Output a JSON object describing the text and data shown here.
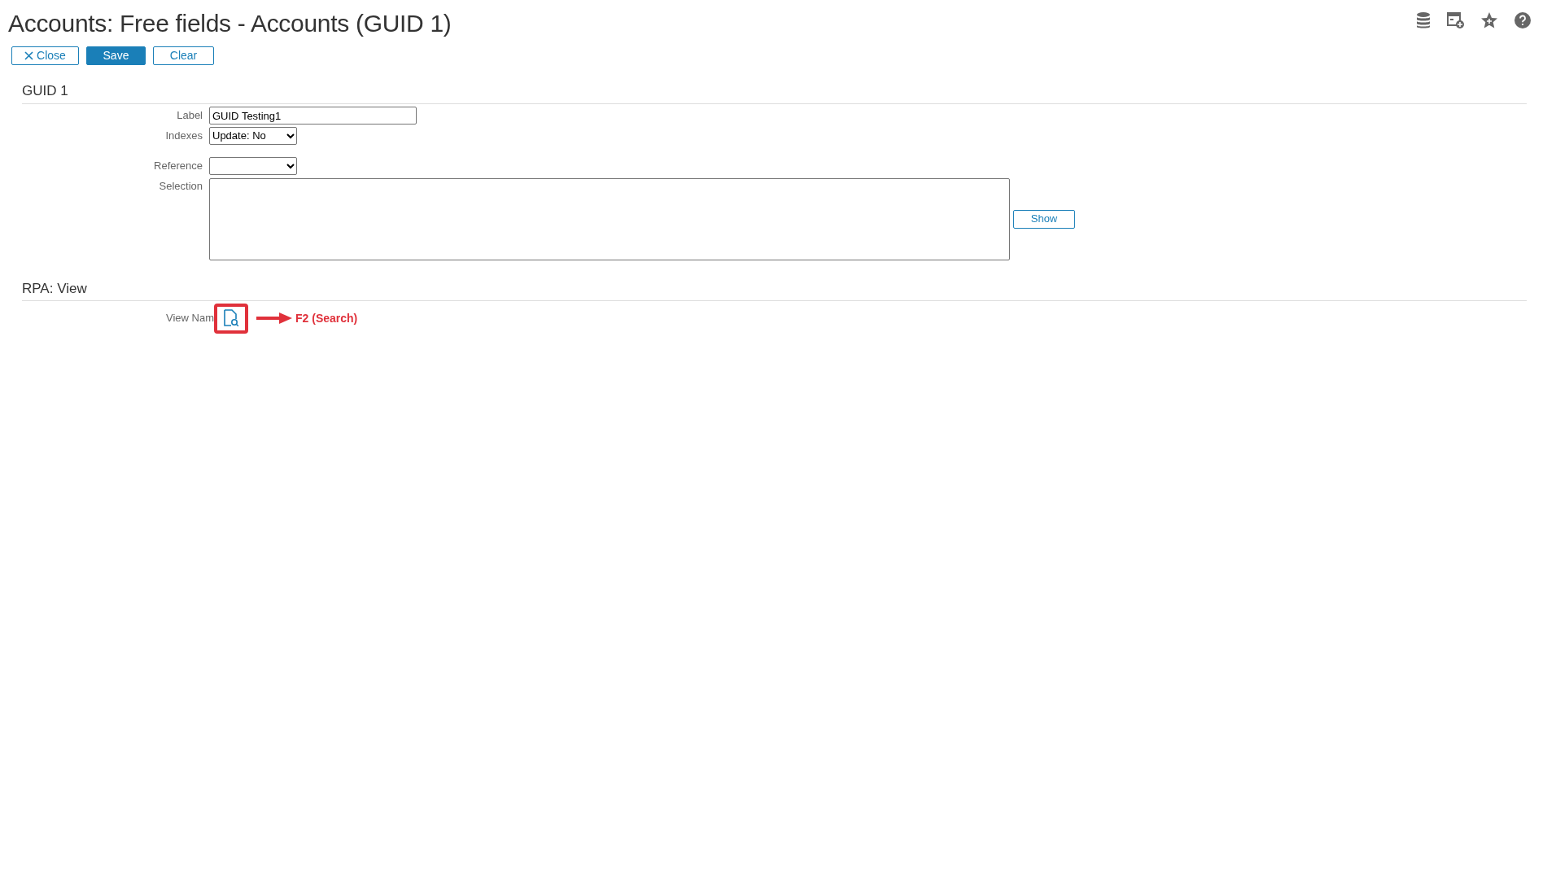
{
  "window": {
    "title": "Accounts: Free fields - Accounts (GUID 1)"
  },
  "toolbar_icons": [
    {
      "kind": "database"
    },
    {
      "kind": "add-widget"
    },
    {
      "kind": "favorite"
    },
    {
      "kind": "help"
    }
  ],
  "buttons": [
    {
      "label": "Close",
      "kind": "close",
      "primary": false
    },
    {
      "label": "Save",
      "kind": "plain",
      "primary": true
    },
    {
      "label": "Clear",
      "kind": "plain",
      "primary": false
    }
  ],
  "sections": [
    {
      "title": "GUID 1",
      "fields": [
        {
          "kind": "text",
          "label": "Label",
          "value": "GUID Testing1"
        },
        {
          "kind": "select",
          "label": "Indexes",
          "value": "Update: No"
        },
        {
          "kind": "select",
          "label": "Reference",
          "gap": true
        },
        {
          "kind": "textarea",
          "label": "Selection",
          "button": "Show"
        }
      ]
    },
    {
      "title": "RPA: View",
      "fields": [
        {
          "kind": "lookup",
          "label": "View Nam",
          "annotation": "F2 (Search)"
        }
      ]
    }
  ]
}
